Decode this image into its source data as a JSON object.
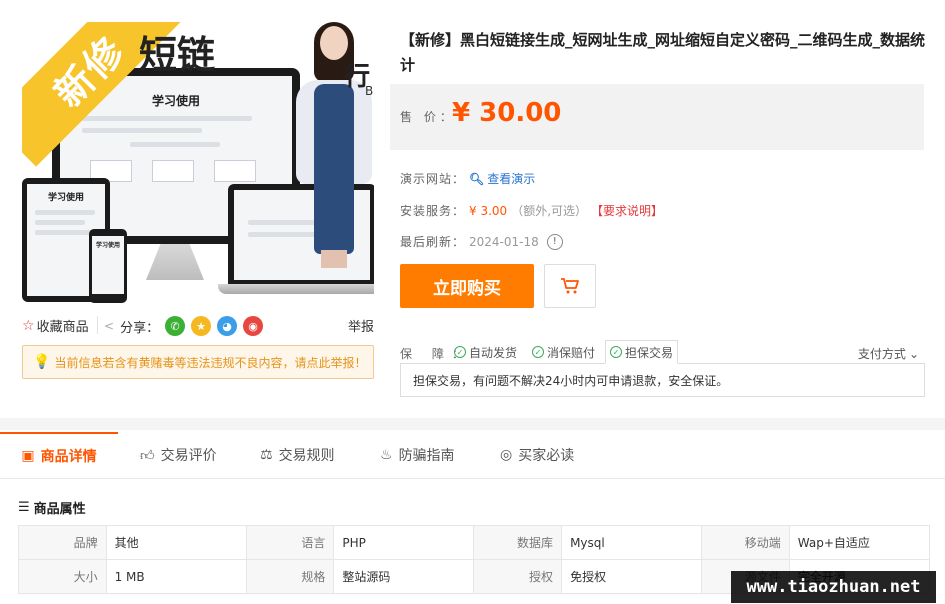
{
  "product_image": {
    "ribbon_text": "新修",
    "title_text": "短链",
    "side_text": "行",
    "side_letter": "B",
    "monitor_screen_title": "学习使用",
    "tablet_screen_title": "学习使用",
    "phone_screen_title": "学习使用"
  },
  "actions": {
    "favorite_label": "收藏商品",
    "share_label": "分享：",
    "report_label": "举报",
    "share_icons": [
      {
        "name": "wechat-icon",
        "color": "#3cb034",
        "glyph": "微"
      },
      {
        "name": "qzone-icon",
        "color": "#f5b820",
        "glyph": "★"
      },
      {
        "name": "qq-icon",
        "color": "#3a9ee8",
        "glyph": "Q"
      },
      {
        "name": "weibo-icon",
        "color": "#e8473f",
        "glyph": "微"
      }
    ]
  },
  "notice": {
    "text": "当前信息若含有黄赌毒等违法违规不良内容，请点此举报！"
  },
  "product": {
    "title": "【新修】黑白短链接生成_短网址生成_网址缩短自定义密码_二维码生成_数据统计",
    "price_label": "售 价：",
    "price": "¥ 30.00",
    "demo_label": "演示网站：",
    "demo_link": "查看演示",
    "install_label": "安装服务：",
    "install_price": "¥ 3.00",
    "install_note": "（额外,可选）",
    "install_req": "【要求说明】",
    "refresh_label": "最后刷新：",
    "refresh_date": "2024-01-18",
    "buy_label": "立即购买"
  },
  "guarantee": {
    "label": "保 障：",
    "items": [
      "自动发货",
      "消保赔付",
      "担保交易"
    ],
    "pay_method": "支付方式",
    "detail": "担保交易，有问题不解决24小时内可申请退款，安全保证。"
  },
  "tabs": [
    {
      "label": "商品详情",
      "icon": "shop-icon",
      "active": true
    },
    {
      "label": "交易评价",
      "icon": "thumb-up-icon",
      "active": false
    },
    {
      "label": "交易规则",
      "icon": "scale-icon",
      "active": false
    },
    {
      "label": "防骗指南",
      "icon": "bulb-icon",
      "active": false
    },
    {
      "label": "买家必读",
      "icon": "compass-icon",
      "active": false
    }
  ],
  "attributes": {
    "title": "商品属性",
    "rows": [
      [
        [
          "品牌",
          "其他"
        ],
        [
          "语言",
          "PHP"
        ],
        [
          "数据库",
          "Mysql"
        ],
        [
          "移动端",
          "Wap+自适应"
        ]
      ],
      [
        [
          "大小",
          "1 MB"
        ],
        [
          "规格",
          "整站源码"
        ],
        [
          "授权",
          "免授权"
        ],
        [
          "源文件",
          "完全开源"
        ]
      ]
    ]
  },
  "watermark": "www.tiaozhuan.net",
  "colors": {
    "accent": "#ff5500",
    "buy_button": "#ff7c00",
    "notice_text": "#e6931a",
    "link": "#2a74d1",
    "check_green": "#3daa5c"
  }
}
